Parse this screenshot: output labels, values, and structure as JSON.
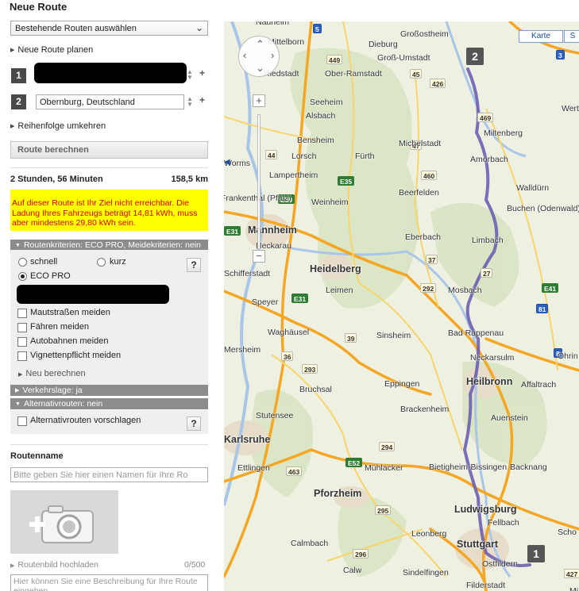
{
  "panel": {
    "title": "Neue Route",
    "existing_routes_select": "Bestehende Routen auswählen",
    "plan_new_route": "Neue Route planen",
    "waypoints": [
      {
        "number": "1",
        "value": ""
      },
      {
        "number": "2",
        "value": "Obernburg, Deutschland"
      }
    ],
    "reverse_order": "Reihenfolge umkehren",
    "calculate_button": "Route berechnen",
    "duration": "2 Stunden, 56 Minuten",
    "distance": "158,5 km",
    "warning": "Auf dieser Route ist Ihr Ziel nicht erreichbar. Die Ladung Ihres Fahrzeugs beträgt 14,81 kWh, muss aber mindestens 29,80 kWh sein.",
    "criteria_header": "Routenkriterien: ECO PRO, Meidekriterien: nein",
    "route_modes": [
      "schnell",
      "kurz",
      "ECO PRO"
    ],
    "selected_mode": "ECO PRO",
    "avoid_options": [
      "Mautstraßen meiden",
      "Fähren meiden",
      "Autobahnen meiden",
      "Vignettenpflicht meiden"
    ],
    "recalculate": "Neu berechnen",
    "traffic_header": "Verkehrslage: ja",
    "alternatives_header": "Alternativrouten: nein",
    "suggest_alternatives": "Alternativrouten vorschlagen",
    "help_label": "?",
    "route_name_title": "Routenname",
    "route_name_placeholder": "Bitte geben Sie hier einen Namen für Ihre Ro",
    "upload_image": "Routenbild hochladen",
    "char_counter": "0/500",
    "description_placeholder": "Hier können Sie eine Beschreibung für Ihre Route eingeben"
  },
  "map": {
    "type_buttons": [
      "Karte",
      "S"
    ],
    "zoom_in": "+",
    "zoom_out": "−",
    "markers": [
      "2",
      "1"
    ],
    "city_labels": [
      "Nauheim",
      "Großostheim",
      "Mittelborn",
      "Dieburg",
      "Groß-Umstadt",
      "Riedstadt",
      "Ober-Ramstadt",
      "Seeheim",
      "Alsbach",
      "Miltenberg",
      "Bensheim",
      "Michelstadt",
      "Amorbach",
      "Lorsch",
      "Fürth",
      "Worms",
      "Lampertheim",
      "Walldürn",
      "Frankenthal (Pfalz)",
      "Weinheim",
      "Beerfelden",
      "Buchen (Odenwald)",
      "Mannheim",
      "Eberbach",
      "Limbach",
      "Neckarau",
      "Schifferstadt",
      "Heidelberg",
      "Speyer",
      "Leimen",
      "Mosbach",
      "Waghäusel",
      "Sinsheim",
      "Bad Rappenau",
      "Mersheim",
      "Neckarsulm",
      "Öhrin",
      "Bruchsal",
      "Eppingen",
      "Heilbronn",
      "Affaltrach",
      "Stutensee",
      "Brackenheim",
      "Auenstein",
      "Karlsruhe",
      "Ettlingen",
      "Mühlacker",
      "Bietigheim-Bissingen",
      "Backnang",
      "Pforzheim",
      "Ludwigsburg",
      "Leonberg",
      "Fellbach",
      "Scho",
      "Calmbach",
      "Stuttgart",
      "Calw",
      "Sindelfingen",
      "Ostfildern",
      "Filderstadt",
      "Wertl",
      "Mü"
    ],
    "road_labels": [
      "5",
      "449",
      "3",
      "426",
      "45",
      "469",
      "44",
      "47",
      "E35",
      "460",
      "E50",
      "E31",
      "37",
      "27",
      "292",
      "E41",
      "81",
      "E31",
      "39",
      "36",
      "293",
      "294",
      "E52",
      "463",
      "295",
      "296",
      "427",
      "8"
    ]
  }
}
